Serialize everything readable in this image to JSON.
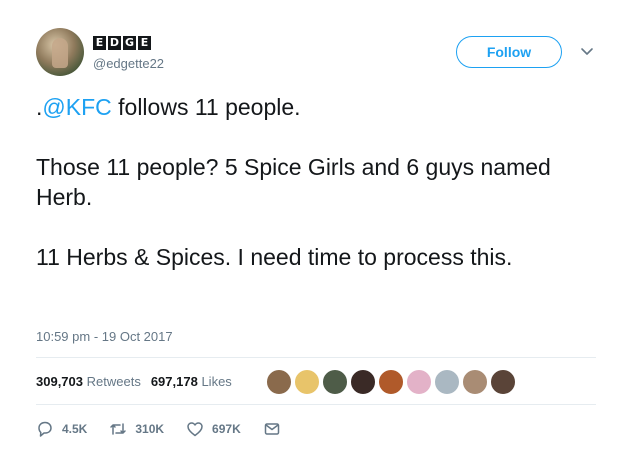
{
  "user": {
    "display_name_letters": [
      "E",
      "D",
      "G",
      "E"
    ],
    "handle": "@edgette22"
  },
  "follow_button": {
    "label": "Follow"
  },
  "tweet": {
    "mention": "@KFC",
    "line1_prefix": ".",
    "line1_rest": " follows 11 people.",
    "line2": "Those 11 people? 5 Spice Girls and 6 guys named Herb.",
    "line3": "11 Herbs & Spices. I need time to process this."
  },
  "timestamp": "10:59 pm - 19 Oct 2017",
  "stats": {
    "retweets_count": "309,703",
    "retweets_label": "Retweets",
    "likes_count": "697,178",
    "likes_label": "Likes"
  },
  "liker_avatars": [
    {
      "name": "liker-1",
      "color": "#8a6a4c"
    },
    {
      "name": "liker-2",
      "color": "#e8c46a"
    },
    {
      "name": "liker-3",
      "color": "#4e5c48"
    },
    {
      "name": "liker-4",
      "color": "#3a2a26"
    },
    {
      "name": "liker-5",
      "color": "#b05a2a"
    },
    {
      "name": "liker-6",
      "color": "#e3b2c8"
    },
    {
      "name": "liker-7",
      "color": "#aab8c2"
    },
    {
      "name": "liker-8",
      "color": "#a98c74"
    },
    {
      "name": "liker-9",
      "color": "#5a4438"
    }
  ],
  "actions": {
    "replies": "4.5K",
    "retweets": "310K",
    "likes": "697K"
  },
  "colors": {
    "accent": "#1da1f2",
    "muted": "#657786",
    "text": "#14171a"
  }
}
